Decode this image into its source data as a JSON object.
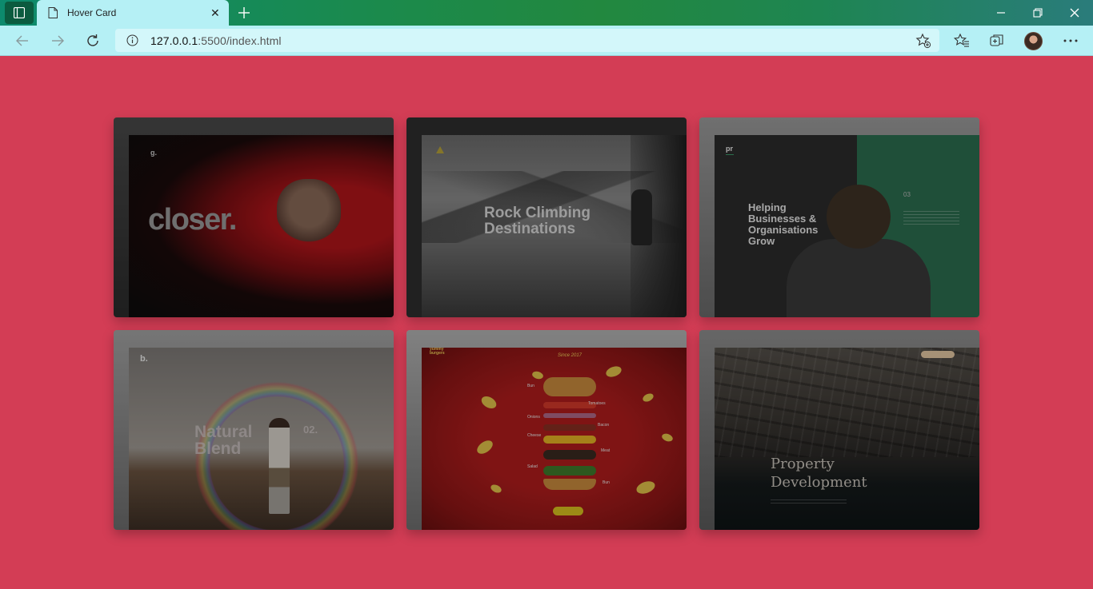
{
  "browser": {
    "tab_title": "Hover Card",
    "url_host": "127.0.0.1",
    "url_rest": ":5500/index.html"
  },
  "colors": {
    "page_background": "#d33d55",
    "titlebar": "#1b8a4c",
    "toolbar": "#b5f0f5"
  },
  "icons": [
    "sidebar-icon",
    "page-icon",
    "close-icon",
    "plus-icon",
    "minimize-icon",
    "restore-icon",
    "window-close-icon",
    "back-icon",
    "forward-icon",
    "refresh-icon",
    "info-icon",
    "add-favorite-icon",
    "favorites-icon",
    "collections-icon",
    "avatar",
    "more-icon"
  ],
  "cards": [
    {
      "logo": "g.",
      "title": "closer."
    },
    {
      "title_line1": "Rock Climbing",
      "title_line2": "Destinations"
    },
    {
      "logo": "pr",
      "title": "Helping Businesses & Organisations Grow",
      "number": "03"
    },
    {
      "logo": "b.",
      "title_line1": "Natural",
      "title_line2": "Blend",
      "number": "02."
    },
    {
      "logo_line1": "yummy",
      "logo_line2": "burgers",
      "since": "Since 2017",
      "labels": [
        "Bun",
        "Tomatoes",
        "Onions",
        "Bacon",
        "Cheese",
        "Meat",
        "Salad",
        "Bun"
      ]
    },
    {
      "title_line1": "Property",
      "title_line2": "Development"
    }
  ]
}
